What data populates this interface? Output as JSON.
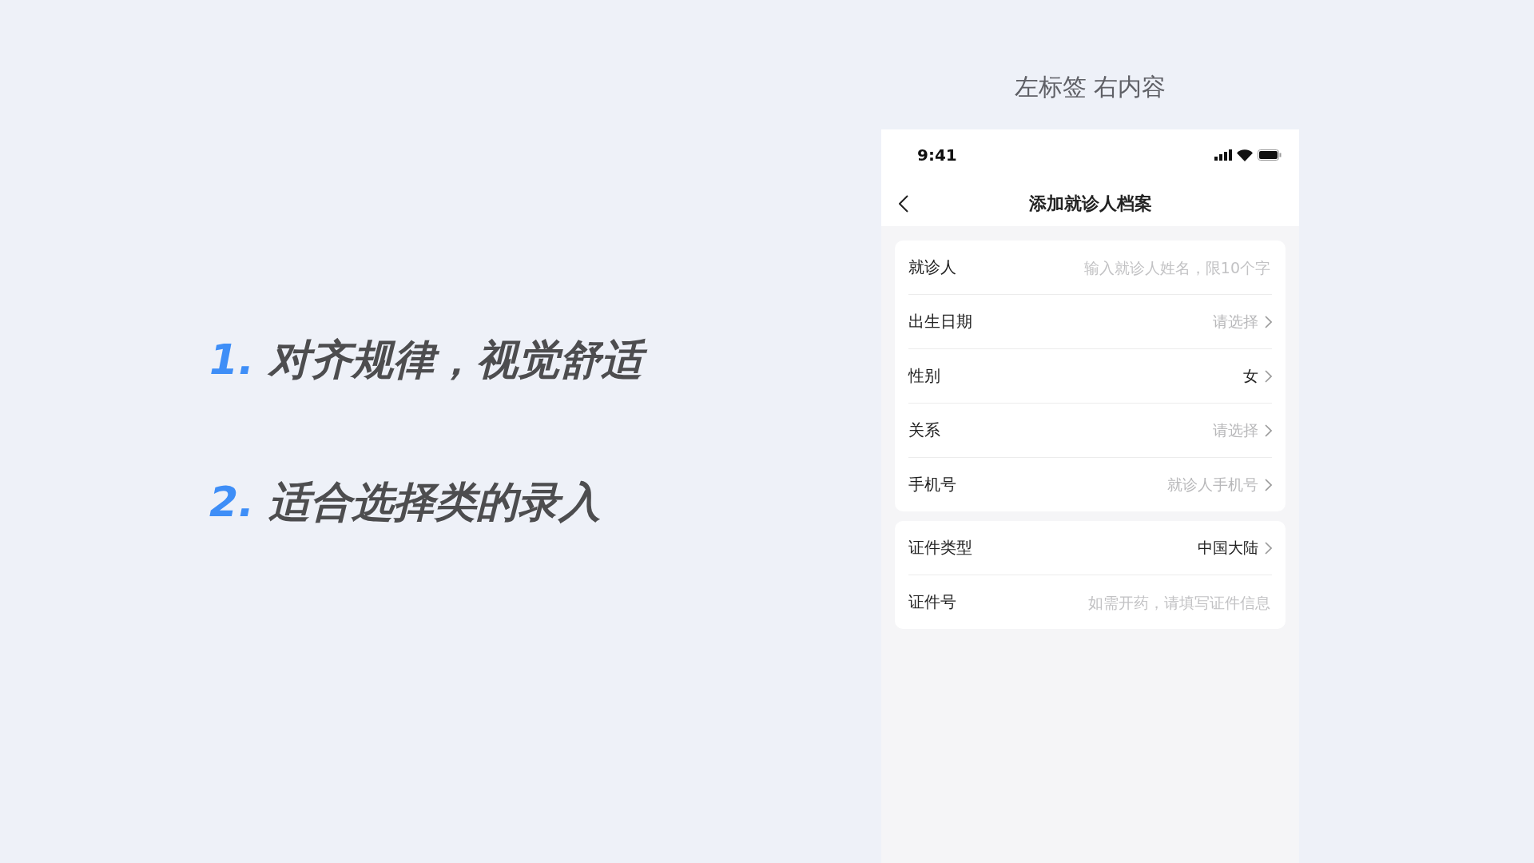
{
  "heading": "左标签 右内容",
  "points": [
    {
      "number": "1.",
      "text": "对齐规律，视觉舒适"
    },
    {
      "number": "2.",
      "text": "适合选择类的录入"
    }
  ],
  "phone": {
    "time": "9:41",
    "title": "添加就诊人档案",
    "groups": [
      {
        "rows": [
          {
            "kind": "input",
            "label": "就诊人",
            "placeholder": "输入就诊人姓名，限10个字"
          },
          {
            "kind": "select",
            "label": "出生日期",
            "placeholder": "请选择"
          },
          {
            "kind": "select",
            "label": "性别",
            "value": "女"
          },
          {
            "kind": "select",
            "label": "关系",
            "placeholder": "请选择"
          },
          {
            "kind": "select",
            "label": "手机号",
            "placeholder": "就诊人手机号"
          }
        ]
      },
      {
        "rows": [
          {
            "kind": "select",
            "label": "证件类型",
            "value": "中国大陆"
          },
          {
            "kind": "input",
            "label": "证件号",
            "placeholder": "如需开药，请填写证件信息"
          }
        ]
      }
    ]
  }
}
